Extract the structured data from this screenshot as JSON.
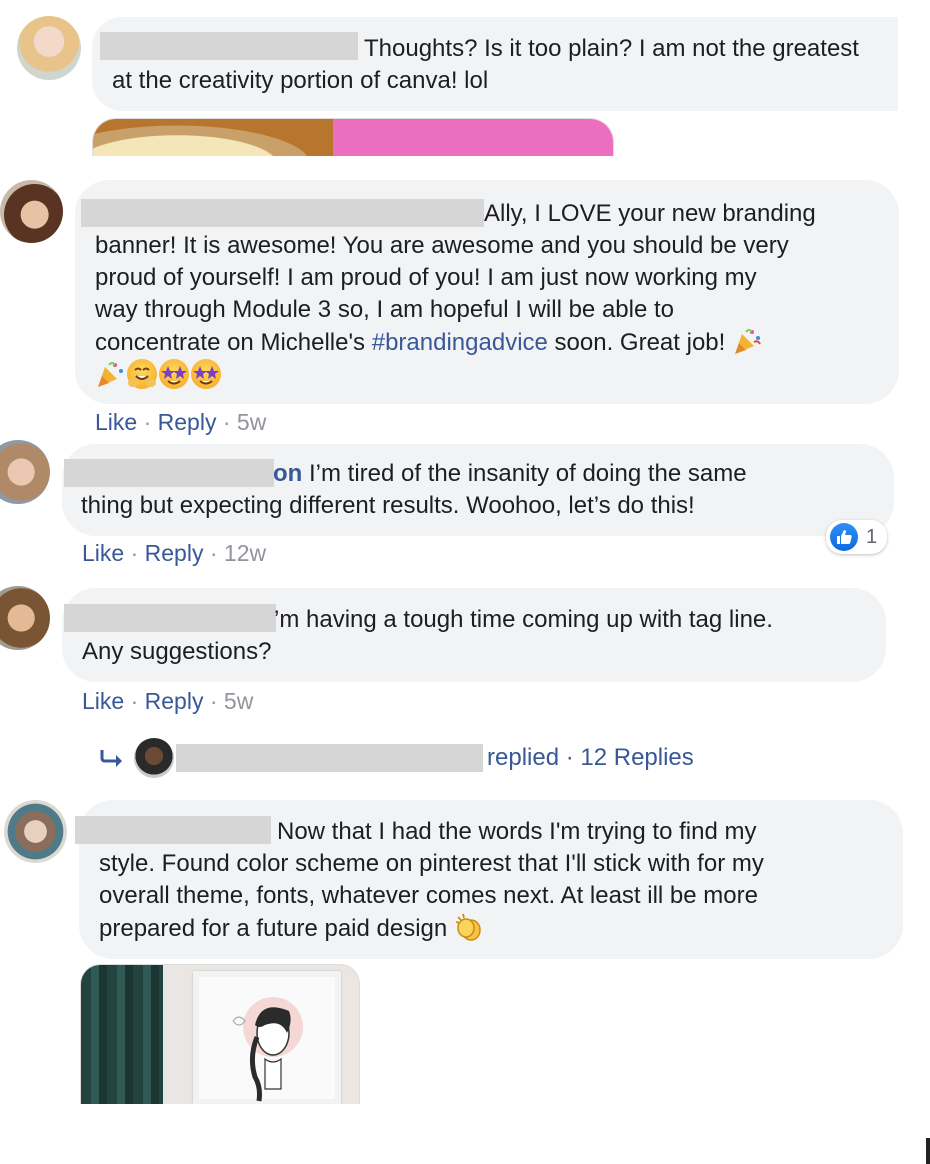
{
  "comments": [
    {
      "text": "Thoughts? Is it too plain? I am not the greatest at the creativity portion of canva! lol"
    },
    {
      "text_line1": "Ally, I LOVE your new branding",
      "text_line2": "banner! It is awesome! You are awesome and you should be very",
      "text_line3": "proud of yourself! I am proud of you! I am just now working my",
      "text_line4": "way through Module 3 so, I am hopeful I will be able to",
      "text_line5_pre": "concentrate on Michelle's ",
      "hashtag": "#brandingadvice",
      "text_line5_post": " soon. Great job!",
      "actions": {
        "like": "Like",
        "sep1": " · ",
        "reply": "Reply",
        "sep2": " · ",
        "time": "5w"
      }
    },
    {
      "name_tail": "on",
      "text_line1": " I’m tired of the insanity of doing the same",
      "text_line2": "thing but expecting different results. Woohoo, let’s do this!",
      "reaction_count": "1",
      "actions": {
        "like": "Like",
        "sep1": " · ",
        "reply": "Reply",
        "sep2": " · ",
        "time": "12w"
      }
    },
    {
      "text_line1": "’m having a tough time coming up with tag line.",
      "text_line2": "Any suggestions?",
      "actions": {
        "like": "Like",
        "sep1": " · ",
        "reply": "Reply",
        "sep2": " · ",
        "time": "5w"
      },
      "replies": {
        "replied": "replied",
        "sep": " · ",
        "count": "12 Replies"
      }
    },
    {
      "text_line1": "Now that I had the words I'm trying to find my",
      "text_line2": "style. Found color scheme on pinterest that I'll stick with for my",
      "text_line3": "overall theme, fonts, whatever comes next. At least ill be more",
      "text_line4": "prepared for a future paid design"
    }
  ],
  "icons": {
    "reply_arrow": "reply-arrow-icon",
    "like_reaction": "thumbs-up-icon",
    "party": "party-popper-emoji",
    "hugging": "hugging-face-emoji",
    "star_struck": "star-struck-emoji",
    "clapping": "clapping-hands-emoji"
  },
  "colors": {
    "bubble": "#f2f3f5",
    "link": "#385898",
    "meta": "#90949c",
    "redaction": "#d6d6d6",
    "pink_banner": "#ec6fbf"
  }
}
